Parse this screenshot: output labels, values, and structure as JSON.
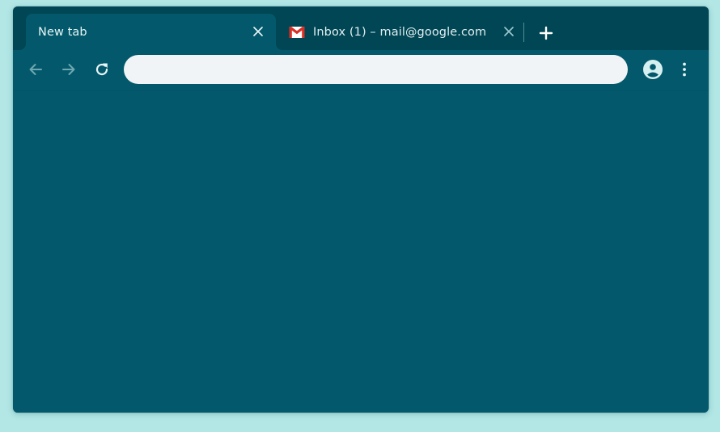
{
  "browser": {
    "tabs": [
      {
        "title": "New tab",
        "active": true
      },
      {
        "title": "Inbox (1) – mail@google.com",
        "active": false,
        "favicon": "gmail-icon"
      }
    ],
    "new_tab_icon": "plus-icon",
    "omnibox": {
      "value": "",
      "placeholder": ""
    },
    "toolbar_icons": [
      "back-arrow-icon",
      "forward-arrow-icon",
      "reload-icon",
      "account-icon",
      "more-vertical-icon"
    ]
  },
  "colors": {
    "desktop": "#b2e7e6",
    "tabstrip": "#014654",
    "toolbar": "#03596b",
    "omnibox": "#f1f4f6",
    "icon": "#cfe9eb"
  }
}
